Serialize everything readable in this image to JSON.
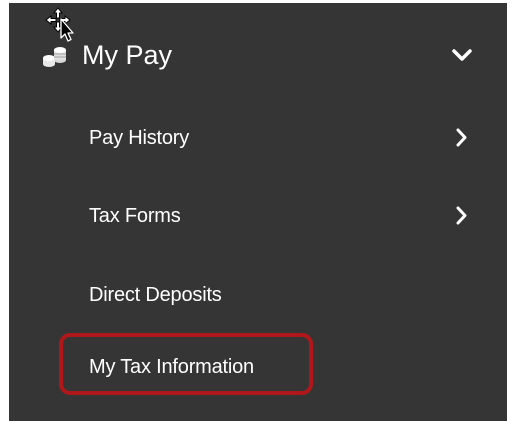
{
  "menu": {
    "header": {
      "label": "My Pay",
      "icon": "coins-icon",
      "expand_icon": "chevron-down-icon"
    },
    "items": [
      {
        "label": "Pay History",
        "has_submenu": true,
        "icon": "chevron-right-icon"
      },
      {
        "label": "Tax Forms",
        "has_submenu": true,
        "icon": "chevron-right-icon"
      },
      {
        "label": "Direct Deposits",
        "has_submenu": false
      },
      {
        "label": "My Tax Information",
        "has_submenu": false,
        "highlighted": true
      }
    ]
  },
  "colors": {
    "panel_bg": "#353535",
    "text": "#ffffff",
    "highlight_border": "#b0171a"
  },
  "cursor": "move-cursor-icon"
}
